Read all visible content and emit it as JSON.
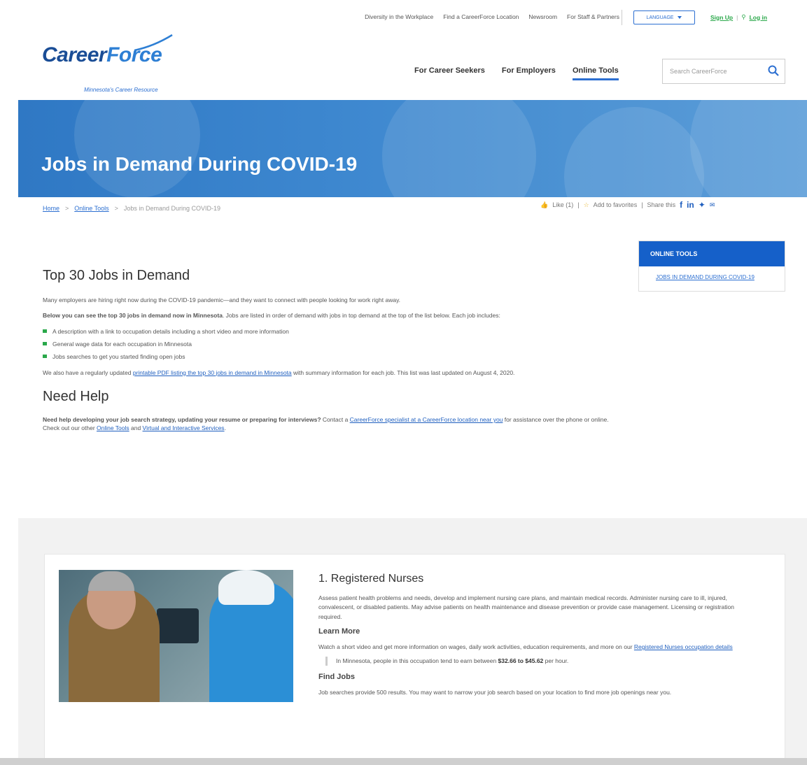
{
  "utility": {
    "links": [
      "Diversity in the Workplace",
      "Find a CareerForce Location",
      "Newsroom",
      "For Staff & Partners"
    ],
    "language_label": "LANGUAGE",
    "signup": "Sign Up",
    "auth_sep": "|",
    "login": "Log in"
  },
  "logo": {
    "career": "Career",
    "force": "Force",
    "tagline": "Minnesota's Career Resource"
  },
  "nav": {
    "items": [
      "For Career Seekers",
      "For Employers",
      "Online Tools"
    ],
    "active": "Online Tools"
  },
  "search": {
    "placeholder": "Search CareerForce"
  },
  "hero": {
    "title": "Jobs in Demand During COVID-19"
  },
  "breadcrumb": {
    "home": "Home",
    "online_tools": "Online Tools",
    "current": "Jobs in Demand During COVID-19",
    "sep": ">"
  },
  "actions": {
    "like": "Like (1)",
    "favorites": "Add to favorites",
    "share": "Share this",
    "sep": "|"
  },
  "sidebar": {
    "title": "ONLINE TOOLS",
    "item": "JOBS IN DEMAND DURING COVID-19"
  },
  "content": {
    "heading": "Top 30 Jobs in Demand",
    "intro": "Many employers are hiring right now during the COVID-19 pandemic—and they want to connect with people looking for work right away.",
    "below_bold": "Below you can see the top 30 jobs in demand now in Minnesota",
    "below_rest": ". Jobs are listed in order of demand with jobs in top demand at the top of the list below. Each job includes:",
    "bullets": [
      "A description with a link to occupation details including a short video and more information",
      "General wage data for each occupation in Minnesota",
      "Jobs searches to get you started finding open jobs"
    ],
    "pdf_pre": "We also have a regularly updated ",
    "pdf_link": "printable PDF listing the top 30 jobs in demand in Minnesota",
    "pdf_post": " with summary information for each job. This list was last updated on August 4, 2020.",
    "need_heading": "Need Help",
    "need_bold": "Need help developing your job search strategy, updating your resume or preparing for interviews?",
    "need_contact": " Contact a ",
    "need_link1": "CareerForce specialist at a CareerForce location near you",
    "need_mid": " for assistance over the phone or online. Check out our other ",
    "need_link2": "Online Tools",
    "need_and": " and ",
    "need_link3": "Virtual and Interactive Services",
    "need_end": "."
  },
  "job": {
    "title": "1. Registered Nurses",
    "description": "Assess patient health problems and needs, develop and implement nursing care plans, and maintain medical records. Administer nursing care to ill, injured, convalescent, or disabled patients. May advise patients on health maintenance and disease prevention or provide case management. Licensing or registration required.",
    "learn_heading": "Learn More",
    "learn_text": "Watch a short video and get more information on wages, daily work activities, education requirements, and more on our ",
    "learn_link": "Registered Nurses occupation details",
    "wage_pre": "In Minnesota, people in this occupation tend to earn between ",
    "wage_range": "$32.66 to $45.62",
    "wage_post": " per hour.",
    "find_heading": "Find Jobs",
    "find_text": "Job searches provide 500 results. You may want to narrow your job search based on your location to find more job openings near you."
  },
  "icons": {
    "search": "search-icon",
    "like": "thumbs-up-icon",
    "favorite": "star-icon",
    "facebook": "facebook-icon",
    "linkedin": "linkedin-icon",
    "twitter": "twitter-icon",
    "email": "email-icon"
  },
  "colors": {
    "brand_blue": "#1560c9",
    "link": "#1f5fbf",
    "accent_green": "#2aa84a"
  }
}
